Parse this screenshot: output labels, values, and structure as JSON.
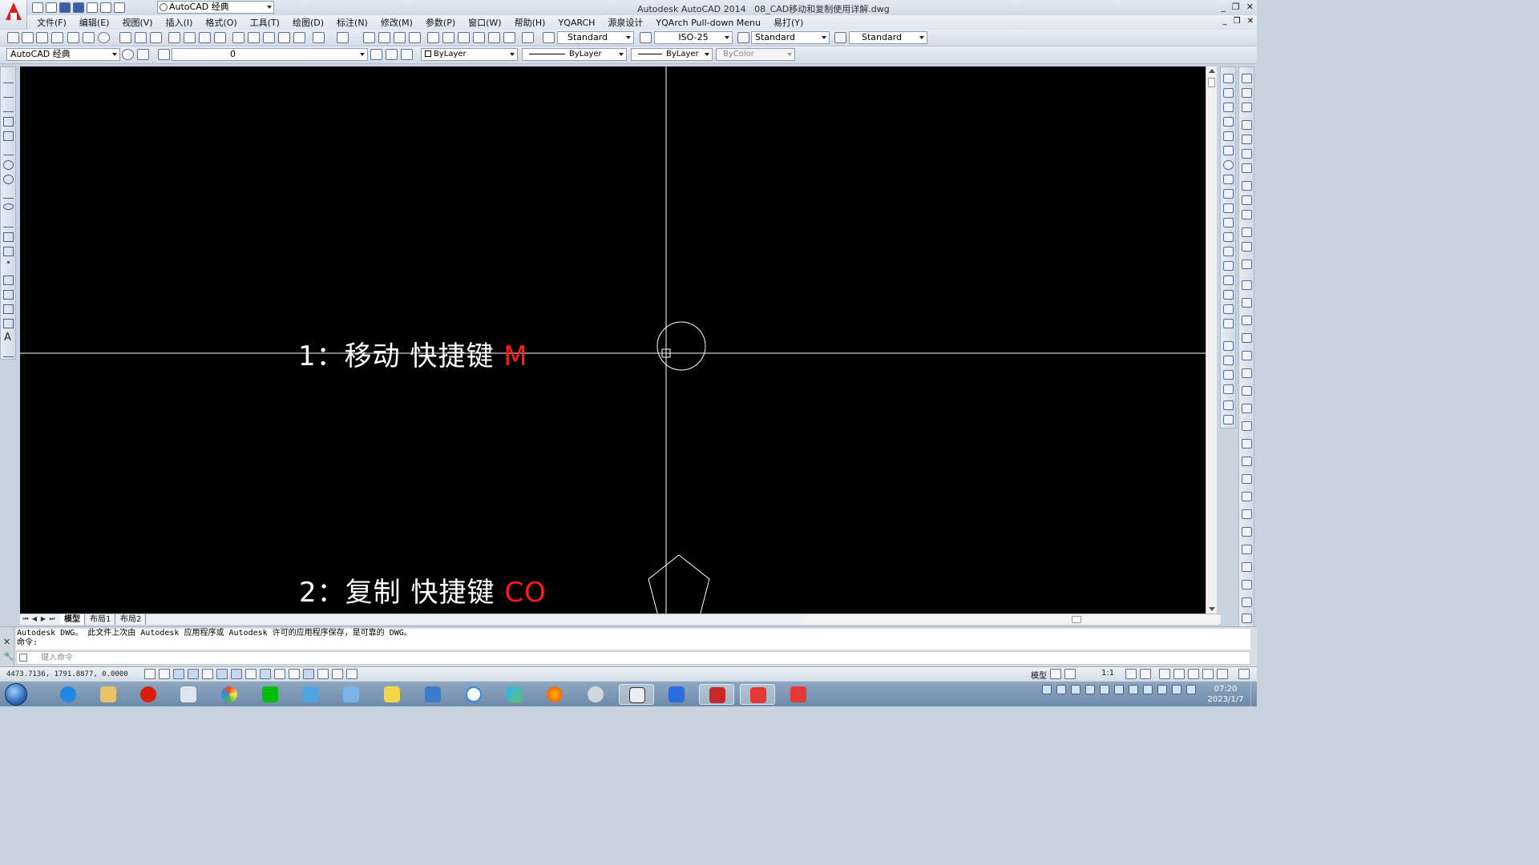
{
  "title_bar": {
    "workspace": "AutoCAD 经典",
    "app_title": "Autodesk AutoCAD 2014",
    "file_name": "08_CAD移动和复制使用详解.dwg",
    "controls": [
      "_",
      "❐",
      "✕"
    ]
  },
  "menu": {
    "items": [
      "文件(F)",
      "编辑(E)",
      "视图(V)",
      "插入(I)",
      "格式(O)",
      "工具(T)",
      "绘图(D)",
      "标注(N)",
      "修改(M)",
      "参数(P)",
      "窗口(W)",
      "帮助(H)",
      "YQARCH",
      "源泉设计",
      "YQArch Pull-down Menu",
      "易打(Y)"
    ],
    "controls": [
      "_",
      "❐",
      "✕"
    ]
  },
  "styles_toolbar": {
    "text_style": "Standard",
    "dim_style": "ISO-25",
    "table_style": "Standard",
    "mleader_style": "Standard"
  },
  "layers_toolbar": {
    "workspace": "AutoCAD 经典",
    "layer": "0",
    "color": "ByLayer",
    "linetype": "ByLayer",
    "lineweight": "ByLayer",
    "plot_style": "ByColor"
  },
  "left_tools": {
    "text_tool": "A"
  },
  "canvas": {
    "line1_prefix": "1：移动  快捷键 ",
    "line1_key": "M",
    "line2_prefix": "2：复制  快捷键 ",
    "line2_key": "CO",
    "background": "#000000",
    "key_color": "#ff1a1a"
  },
  "layout_tabs": {
    "nav": [
      "⏮",
      "◀",
      "▶",
      "⏭"
    ],
    "tabs": [
      "模型",
      "布局1",
      "布局2"
    ]
  },
  "command": {
    "history_line1": "Autodesk DWG。  此文件上次由 Autodesk 应用程序或 Autodesk 许可的应用程序保存，是可靠的 DWG。",
    "history_line2": "命令:",
    "placeholder": "键入命令"
  },
  "statusbar": {
    "coords": "4473.7136,  1791.8877, 0.0000",
    "model": "模型",
    "scale": "1:1"
  },
  "taskbar": {
    "time": "07:20",
    "date": "2023/1/7"
  }
}
